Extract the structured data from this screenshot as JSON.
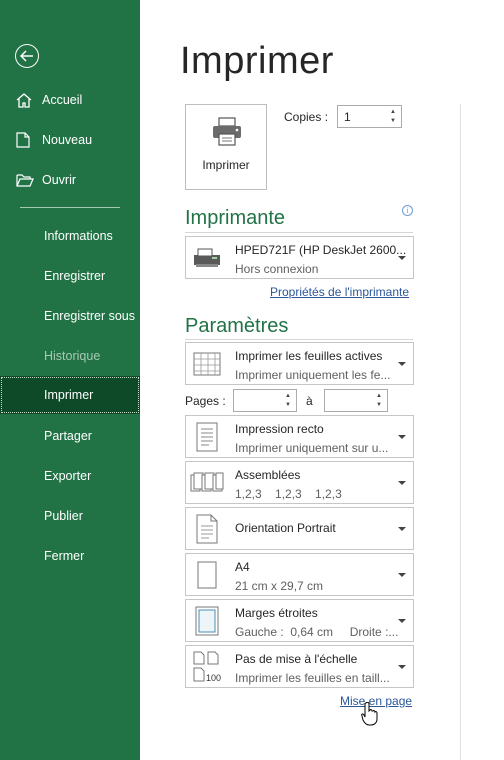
{
  "sidebar": {
    "items": [
      {
        "label": "Accueil",
        "icon": "home-icon"
      },
      {
        "label": "Nouveau",
        "icon": "new-document-icon"
      },
      {
        "label": "Ouvrir",
        "icon": "open-folder-icon"
      },
      {
        "label": "Informations"
      },
      {
        "label": "Enregistrer"
      },
      {
        "label": "Enregistrer sous"
      },
      {
        "label": "Historique",
        "disabled": true
      },
      {
        "label": "Imprimer",
        "active": true
      },
      {
        "label": "Partager"
      },
      {
        "label": "Exporter"
      },
      {
        "label": "Publier"
      },
      {
        "label": "Fermer"
      }
    ],
    "colors": {
      "background": "#217346",
      "active": "#0e4a27"
    }
  },
  "page": {
    "title": "Imprimer"
  },
  "print": {
    "button_label": "Imprimer",
    "copies_label": "Copies :",
    "copies_value": "1"
  },
  "printer": {
    "heading": "Imprimante",
    "name": "HPED721F (HP DeskJet 2600...",
    "status": "Hors connexion",
    "properties_link": "Propriétés de l'imprimante"
  },
  "settings": {
    "heading": "Paramètres",
    "sheets": {
      "line1": "Imprimer les feuilles actives",
      "line2": "Imprimer uniquement les fe..."
    },
    "pages_label": "Pages :",
    "pages_from": "",
    "pages_to_label": "à",
    "pages_to": "",
    "sides": {
      "line1": "Impression recto",
      "line2": "Imprimer uniquement sur u..."
    },
    "collate": {
      "line1": "Assemblées",
      "line2": "1,2,3    1,2,3    1,2,3"
    },
    "orientation": {
      "line1": "Orientation Portrait"
    },
    "paper": {
      "line1": "A4",
      "line2": "21 cm x 29,7 cm"
    },
    "margins": {
      "line1": "Marges étroites",
      "line2": "Gauche :  0,64 cm     Droite :..."
    },
    "scaling": {
      "line1": "Pas de mise à l'échelle",
      "line2": "Imprimer les feuilles en taill..."
    },
    "page_setup_link": "Mise en page"
  },
  "accent_color": "#217346",
  "link_color": "#2b579a"
}
